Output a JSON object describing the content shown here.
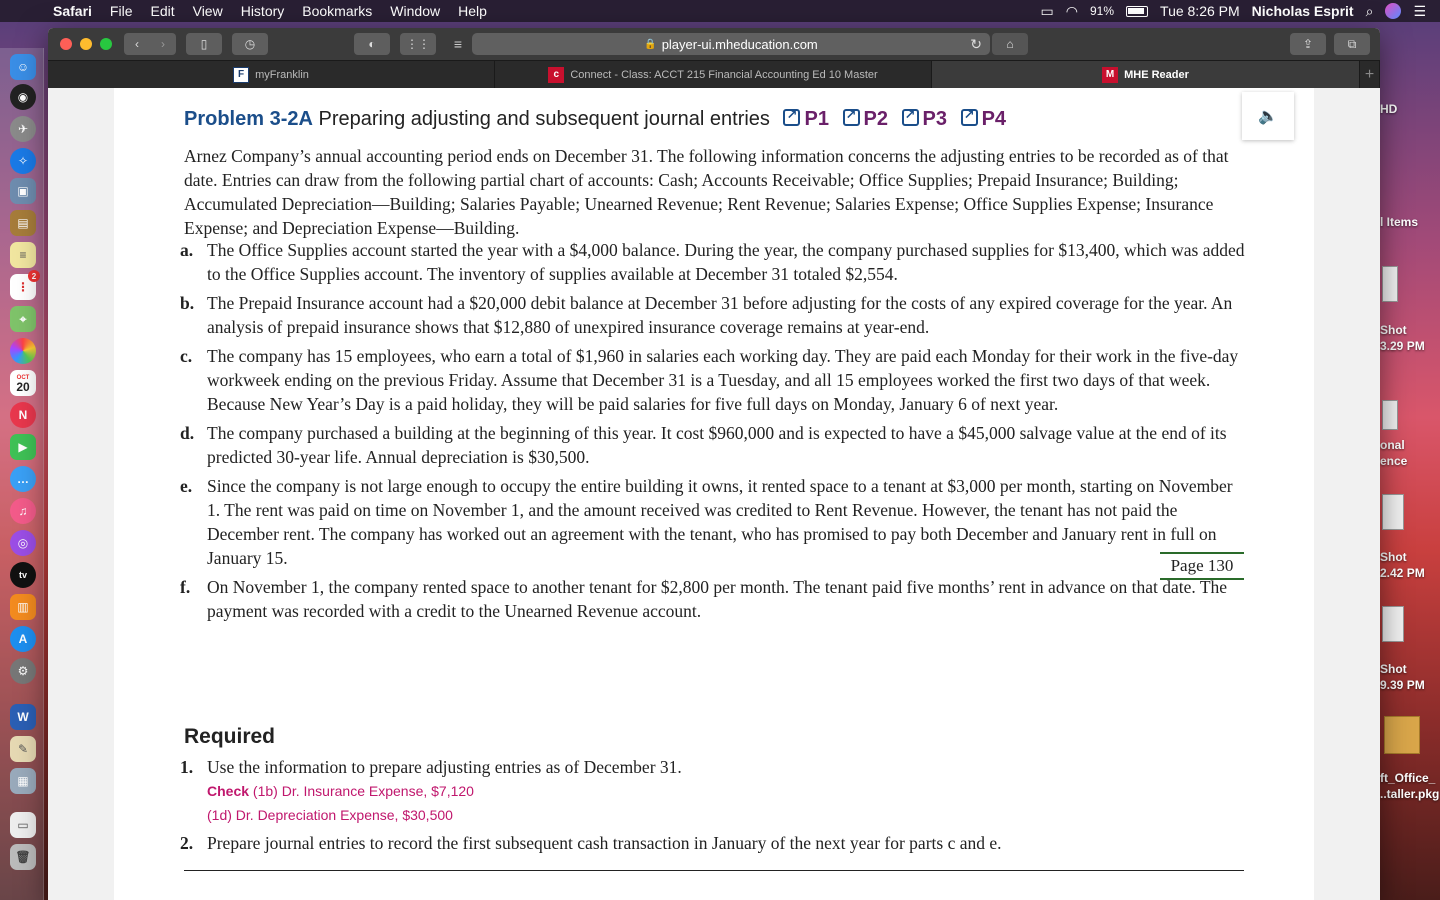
{
  "menubar": {
    "app": "Safari",
    "items": [
      "File",
      "Edit",
      "View",
      "History",
      "Bookmarks",
      "Window",
      "Help"
    ],
    "battery": "91%",
    "clock": "Tue 8:26 PM",
    "user": "Nicholas Esprit"
  },
  "browser": {
    "url": "player-ui.mheducation.com",
    "tabs": [
      {
        "label": "myFranklin"
      },
      {
        "label": "Connect - Class: ACCT 215 Financial Accounting Ed 10 Master"
      },
      {
        "label": "MHE Reader"
      }
    ]
  },
  "desktop_labels": {
    "hd": "HD",
    "items": "l Items",
    "shot1_a": "Shot",
    "shot1_b": "3.29 PM",
    "onal_a": "onal",
    "onal_b": "ence",
    "shot2_a": "Shot",
    "shot2_b": "2.42 PM",
    "shot3_a": "Shot",
    "shot3_b": "9.39 PM",
    "office_a": "ft_Office_",
    "office_b": "..taller.pkg"
  },
  "dock": {
    "calendar_day": "20",
    "calendar_month": "OCT",
    "badge": "2"
  },
  "problem": {
    "number": "Problem 3-2A",
    "title": "Preparing adjusting and subsequent journal entries",
    "learning_objectives": [
      "P1",
      "P2",
      "P3",
      "P4"
    ],
    "intro": "Arnez Company’s annual accounting period ends on December 31. The following information concerns the adjusting entries to be recorded as of that date. Entries can draw from the following partial chart of accounts: Cash; Accounts Receivable; Office Supplies; Prepaid Insurance; Building; Accumulated Depreciation—Building; Salaries Payable; Unearned Revenue; Rent Revenue; Salaries Expense; Office Supplies Expense; Insurance Expense; and Depreciation Expense—Building.",
    "items": [
      {
        "letter": "a.",
        "text": "The Office Supplies account started the year with a $4,000 balance. During the year, the company purchased supplies for $13,400, which was added to the Office Supplies account. The inventory of supplies available at December 31 totaled $2,554."
      },
      {
        "letter": "b.",
        "text": "The Prepaid Insurance account had a $20,000 debit balance at December 31 before adjusting for the costs of any expired coverage for the year. An analysis of prepaid insurance shows that $12,880 of unexpired insurance coverage remains at year-end."
      },
      {
        "letter": "c.",
        "text": "The company has 15 employees, who earn a total of $1,960 in salaries each working day. They are paid each Monday for their work in the five-day workweek ending on the previous Friday. Assume that December 31 is a Tuesday, and all 15 employees worked the first two days of that week. Because New Year’s Day is a paid holiday, they will be paid salaries for five full days on Monday, January 6 of next year."
      },
      {
        "letter": "d.",
        "text": "The company purchased a building at the beginning of this year. It cost $960,000 and is expected to have a $45,000 salvage value at the end of its predicted 30-year life. Annual depreciation is $30,500."
      },
      {
        "letter": "e.",
        "text": "Since the company is not large enough to occupy the entire building it owns, it rented space to a tenant at $3,000 per month, starting on November 1. The rent was paid on time on November 1, and the amount received was credited to Rent Revenue. However, the tenant has not paid the December rent. The company has worked out an agreement with the tenant, who has promised to pay both December and January rent in full on January 15."
      },
      {
        "letter": "f.",
        "text": "On November 1, the company rented space to another tenant for $2,800 per month. The tenant paid five months’ rent in advance on that date. The payment was recorded with a credit to the Unearned Revenue account."
      }
    ],
    "page_marker": "Page 130",
    "required_heading": "Required",
    "required": [
      {
        "num": "1.",
        "text": "Use the information to prepare adjusting entries as of December 31."
      },
      {
        "num": "2.",
        "text": "Prepare journal entries to record the first subsequent cash transaction in January of the next year for parts c and e."
      }
    ],
    "check": {
      "label": "Check",
      "line1_ref": "(1b)",
      "line1_text": "Dr. Insurance Expense, $7,120",
      "line2_ref": "(1d)",
      "line2_text": "Dr. Depreciation Expense, $30,500"
    }
  }
}
